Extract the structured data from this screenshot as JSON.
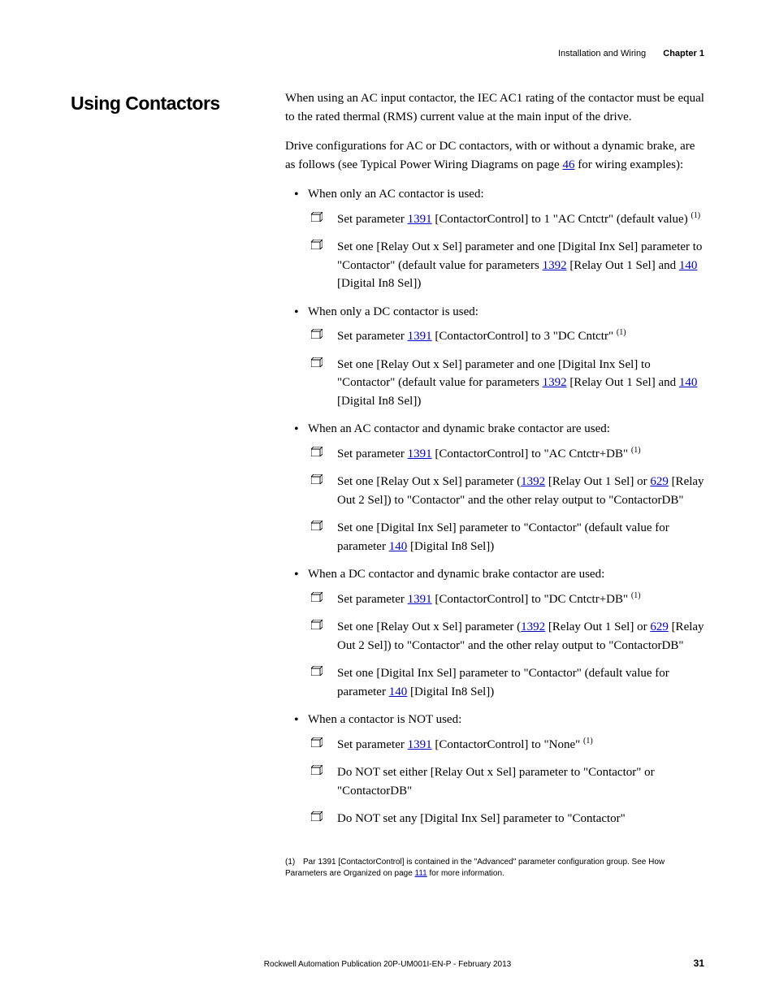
{
  "header": {
    "chapter_title": "Installation and Wiring",
    "chapter_label": "Chapter 1"
  },
  "section_heading": "Using Contactors",
  "paragraphs": {
    "p1": "When using an AC input contactor, the IEC AC1 rating of the contactor must be equal to the rated thermal (RMS) current value at the main input of the drive.",
    "p2a": "Drive configurations for AC or DC contactors, with or without a dynamic brake, are as follows (see Typical Power Wiring Diagrams on page ",
    "p2_link": "46",
    "p2b": " for wiring examples):"
  },
  "bullets": {
    "b1": "When only an AC contactor is used:",
    "b1_items": {
      "i1a": "Set parameter ",
      "i1_link1": "1391",
      "i1b": " [ContactorControl] to 1 \"AC Cntctr\" (default value) ",
      "i2a": "Set one [Relay Out x Sel] parameter and one [Digital Inx Sel] parameter to \"Contactor\" (default value for parameters ",
      "i2_link1": "1392",
      "i2b": " [Relay Out 1 Sel] and ",
      "i2_link2": "140",
      "i2c": " [Digital In8 Sel])"
    },
    "b2": "When only a DC contactor is used:",
    "b2_items": {
      "i1a": "Set parameter ",
      "i1_link1": "1391",
      "i1b": " [ContactorControl] to 3 \"DC Cntctr\" ",
      "i2a": "Set one [Relay Out x Sel] parameter and one [Digital Inx Sel] to \"Contactor\" (default value for parameters ",
      "i2_link1": "1392",
      "i2b": " [Relay Out 1 Sel] and ",
      "i2_link2": "140",
      "i2c": " [Digital In8 Sel])"
    },
    "b3": "When an AC contactor and dynamic brake contactor are used:",
    "b3_items": {
      "i1a": "Set parameter ",
      "i1_link1": "1391",
      "i1b": " [ContactorControl] to \"AC Cntctr+DB\" ",
      "i2a": "Set one [Relay Out x Sel] parameter (",
      "i2_link1": "1392",
      "i2b": " [Relay Out 1 Sel] or ",
      "i2_link2": "629",
      "i2c": " [Relay Out 2 Sel]) to \"Contactor\" and the other relay output to \"ContactorDB\"",
      "i3a": "Set one [Digital Inx Sel] parameter to \"Contactor\" (default value for parameter ",
      "i3_link1": "140",
      "i3b": " [Digital In8 Sel])"
    },
    "b4": "When a DC contactor and dynamic brake contactor are used:",
    "b4_items": {
      "i1a": "Set parameter ",
      "i1_link1": "1391",
      "i1b": " [ContactorControl] to \"DC Cntctr+DB\" ",
      "i2a": "Set one [Relay Out x Sel] parameter (",
      "i2_link1": "1392",
      "i2b": " [Relay Out 1 Sel] or ",
      "i2_link2": "629",
      "i2c": " [Relay Out 2 Sel]) to \"Contactor\" and the other relay output to \"ContactorDB\"",
      "i3a": "Set one [Digital Inx Sel] parameter to \"Contactor\" (default value for parameter ",
      "i3_link1": "140",
      "i3b": " [Digital In8 Sel])"
    },
    "b5": "When a contactor is NOT used:",
    "b5_items": {
      "i1a": "Set parameter ",
      "i1_link1": "1391",
      "i1b": " [ContactorControl] to \"None\" ",
      "i2a": "Do NOT set either [Relay Out x Sel] parameter to \"Contactor\" or \"ContactorDB\"",
      "i3a": "Do NOT set any [Digital Inx Sel] parameter to \"Contactor\""
    }
  },
  "footnote": {
    "num": "(1)",
    "text_a": "Par 1391 [ContactorControl] is contained in the \"Advanced\" parameter configuration group. See How Parameters are Organized on page ",
    "link": "111",
    "text_b": " for more information."
  },
  "footer": {
    "publication": "Rockwell Automation Publication 20P-UM001I-EN-P - February 2013",
    "page": "31"
  },
  "sup1": "(1)"
}
